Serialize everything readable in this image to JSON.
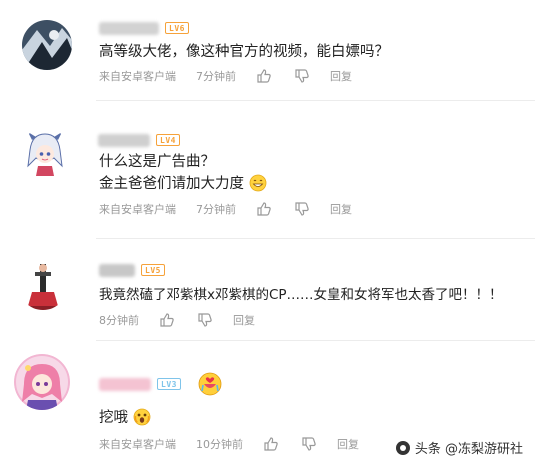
{
  "comments": [
    {
      "level": "LV6",
      "text_lines": [
        "高等级大佬，像这种官方的视频，能白嫖吗？"
      ],
      "source": "来自安卓客户端",
      "time": "7分钟前",
      "reply": "回复",
      "avatar_icon": "abstract-art-avatar"
    },
    {
      "level": "LV4",
      "text_lines": [
        "什么这是广告曲？",
        "金主爸爸们请加大力度"
      ],
      "source": "来自安卓客户端",
      "time": "7分钟前",
      "reply": "回复",
      "avatar_icon": "anime-girl-avatar",
      "emoji": "grinning-face-emoji"
    },
    {
      "level": "LV5",
      "text_lines": [
        "我竟然磕了邓紫棋x邓紫棋的CP……女皇和女将军也太香了吧！！！"
      ],
      "source": "",
      "time": "8分钟前",
      "reply": "回复",
      "avatar_icon": "figure-avatar"
    },
    {
      "level": "LV3",
      "text_lines": [
        "挖哦"
      ],
      "source": "来自安卓客户端",
      "time": "10分钟前",
      "reply": "回复",
      "avatar_icon": "pink-hair-anime-avatar",
      "badge_emoji": "crying-heart-emoji",
      "emoji": "scream-face-emoji"
    }
  ],
  "colors": {
    "lv6": "#f6a23a",
    "lv4": "#f6a23a",
    "lv5": "#f6a23a",
    "lv3": "#7fc4ea",
    "meta": "#999999"
  },
  "watermark": "头条 @冻梨游研社"
}
